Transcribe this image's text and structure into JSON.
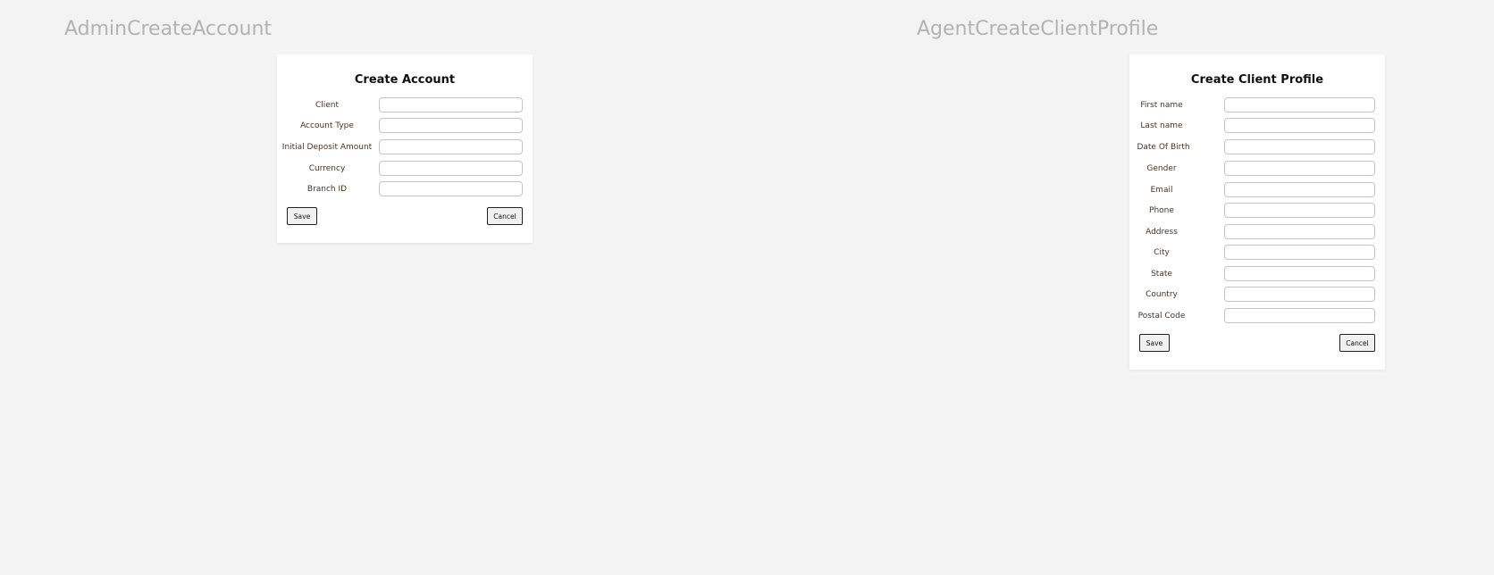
{
  "frames": {
    "admin_create_account": {
      "frame_title": "AdminCreateAccount",
      "form_title": "Create Account",
      "fields": [
        {
          "label": "Client",
          "value": "",
          "placeholder": ""
        },
        {
          "label": "Account Type",
          "value": "",
          "placeholder": ""
        },
        {
          "label": "Initial Deposit Amount",
          "value": "",
          "placeholder": ""
        },
        {
          "label": "Currency",
          "value": "",
          "placeholder": ""
        },
        {
          "label": "Branch ID",
          "value": "",
          "placeholder": ""
        }
      ],
      "save_label": "Save",
      "cancel_label": "Cancel"
    },
    "agent_create_client_profile": {
      "frame_title": "AgentCreateClientProfile",
      "form_title": "Create Client Profile",
      "fields": [
        {
          "label": "First name",
          "value": "",
          "placeholder": ""
        },
        {
          "label": "Last name",
          "value": "",
          "placeholder": ""
        },
        {
          "label": "Date Of Birth",
          "value": "",
          "placeholder": ""
        },
        {
          "label": "Gender",
          "value": "",
          "placeholder": ""
        },
        {
          "label": "Email",
          "value": "",
          "placeholder": ""
        },
        {
          "label": "Phone",
          "value": "",
          "placeholder": ""
        },
        {
          "label": "Address",
          "value": "",
          "placeholder": ""
        },
        {
          "label": "City",
          "value": "",
          "placeholder": ""
        },
        {
          "label": "State",
          "value": "",
          "placeholder": ""
        },
        {
          "label": "Country",
          "value": "",
          "placeholder": ""
        },
        {
          "label": "Postal Code",
          "value": "",
          "placeholder": ""
        }
      ],
      "save_label": "Save",
      "cancel_label": "Cancel"
    }
  },
  "colors": {
    "canvas_background": "#f3f3f3",
    "frame_title": "#b3b3b3",
    "card_background": "#ffffff",
    "label_text": "#4a3424",
    "input_border": "#c4c4c4",
    "button_border": "#222222",
    "button_background": "#f1f1f1"
  }
}
